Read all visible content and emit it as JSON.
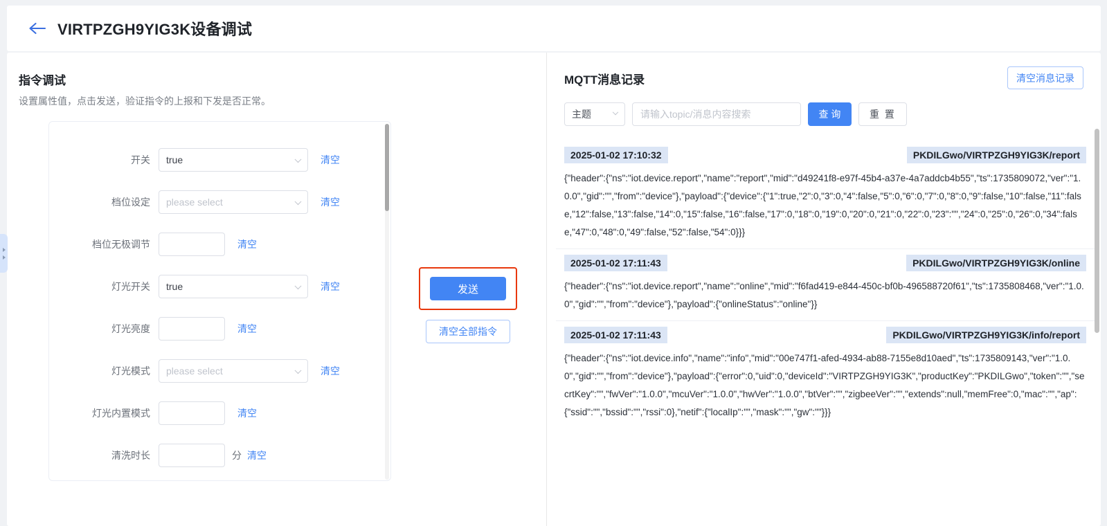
{
  "header": {
    "title": "VIRTPZGH9YIG3K设备调试",
    "back_icon": "arrow-left-icon"
  },
  "left_panel": {
    "section_title": "指令调试",
    "section_subtitle": "设置属性值，点击发送，验证指令的上报和下发是否正常。",
    "fields": [
      {
        "label": "开关",
        "type": "select",
        "value": "true",
        "placeholder": "please select",
        "clear": "清空",
        "unit": ""
      },
      {
        "label": "档位设定",
        "type": "select",
        "value": "",
        "placeholder": "please select",
        "clear": "清空",
        "unit": ""
      },
      {
        "label": "档位无极调节",
        "type": "input",
        "value": "",
        "placeholder": "",
        "clear": "清空",
        "unit": ""
      },
      {
        "label": "灯光开关",
        "type": "select",
        "value": "true",
        "placeholder": "please select",
        "clear": "清空",
        "unit": ""
      },
      {
        "label": "灯光亮度",
        "type": "input",
        "value": "",
        "placeholder": "",
        "clear": "清空",
        "unit": ""
      },
      {
        "label": "灯光模式",
        "type": "select",
        "value": "",
        "placeholder": "please select",
        "clear": "清空",
        "unit": ""
      },
      {
        "label": "灯光内置模式",
        "type": "input",
        "value": "",
        "placeholder": "",
        "clear": "清空",
        "unit": ""
      },
      {
        "label": "清洗时长",
        "type": "input",
        "value": "",
        "placeholder": "",
        "clear": "清空",
        "unit": "分"
      }
    ],
    "send_button": "发送",
    "clear_all_button": "清空全部指令",
    "send_highlight_color": "#e8380d",
    "primary_color": "#4285f4"
  },
  "right_panel": {
    "title": "MQTT消息记录",
    "clear_log_button": "清空消息记录",
    "filter": {
      "topic_select_value": "主题",
      "search_placeholder": "请输入topic/消息内容搜索",
      "search_value": "",
      "query_button": "查 询",
      "reset_button": "重 置"
    },
    "messages": [
      {
        "time": "2025-01-02 17:10:32",
        "topic": "PKDILGwo/VIRTPZGH9YIG3K/report",
        "payload": "{\"header\":{\"ns\":\"iot.device.report\",\"name\":\"report\",\"mid\":\"d49241f8-e97f-45b4-a37e-4a7addcb4b55\",\"ts\":1735809072,\"ver\":\"1.0.0\",\"gid\":\"\",\"from\":\"device\"},\"payload\":{\"device\":{\"1\":true,\"2\":0,\"3\":0,\"4\":false,\"5\":0,\"6\":0,\"7\":0,\"8\":0,\"9\":false,\"10\":false,\"11\":false,\"12\":false,\"13\":false,\"14\":0,\"15\":false,\"16\":false,\"17\":0,\"18\":0,\"19\":0,\"20\":0,\"21\":0,\"22\":0,\"23\":\"\",\"24\":0,\"25\":0,\"26\":0,\"34\":false,\"47\":0,\"48\":0,\"49\":false,\"52\":false,\"54\":0}}}"
      },
      {
        "time": "2025-01-02 17:11:43",
        "topic": "PKDILGwo/VIRTPZGH9YIG3K/online",
        "payload": "{\"header\":{\"ns\":\"iot.device.report\",\"name\":\"online\",\"mid\":\"f6fad419-e844-450c-bf0b-496588720f61\",\"ts\":1735808468,\"ver\":\"1.0.0\",\"gid\":\"\",\"from\":\"device\"},\"payload\":{\"onlineStatus\":\"online\"}}"
      },
      {
        "time": "2025-01-02 17:11:43",
        "topic": "PKDILGwo/VIRTPZGH9YIG3K/info/report",
        "payload": "{\"header\":{\"ns\":\"iot.device.info\",\"name\":\"info\",\"mid\":\"00e747f1-afed-4934-ab88-7155e8d10aed\",\"ts\":1735809143,\"ver\":\"1.0.0\",\"gid\":\"\",\"from\":\"device\"},\"payload\":{\"error\":0,\"uid\":0,\"deviceId\":\"VIRTPZGH9YIG3K\",\"productKey\":\"PKDILGwo\",\"token\":\"\",\"secrtKey\":\"\",\"fwVer\":\"1.0.0\",\"mcuVer\":\"1.0.0\",\"hwVer\":\"1.0.0\",\"btVer\":\"\",\"zigbeeVer\":\"\",\"extends\":null,\"memFree\":0,\"mac\":\"\",\"ap\":{\"ssid\":\"\",\"bssid\":\"\",\"rssi\":0},\"netif\":{\"localIp\":\"\",\"mask\":\"\",\"gw\":\"\"}}}"
      }
    ]
  }
}
